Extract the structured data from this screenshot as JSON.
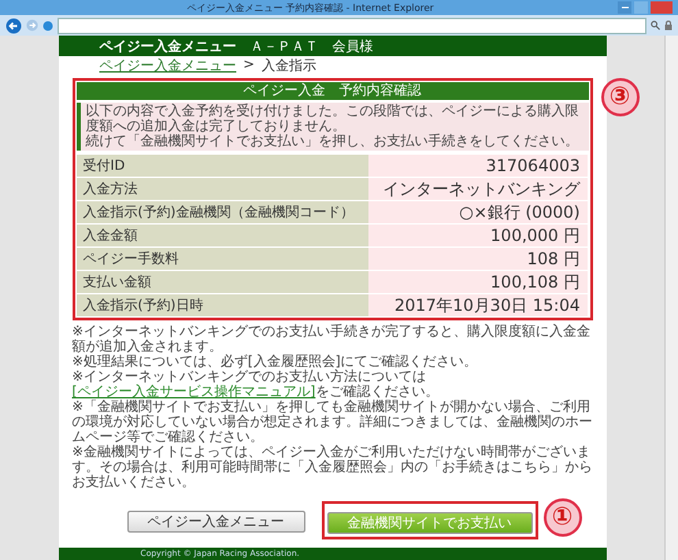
{
  "window": {
    "title": "ペイジー入金メニュー 予約内容確認 - Internet Explorer"
  },
  "header": {
    "title": "ペイジー入金メニュー",
    "subtitle": "Ａ－ＰＡＴ　会員様"
  },
  "breadcrumb": {
    "separator": ">",
    "items": [
      {
        "label": "ペイジー入金メニュー",
        "link": true
      },
      {
        "label": "入金指示",
        "link": false
      }
    ]
  },
  "panel": {
    "title": "ペイジー入金　予約内容確認",
    "annotation": "③",
    "intro": [
      "以下の内容で入金予約を受け付けました。この段階では、ペイジーによる購入限度額への追加入金は完了しておりません。",
      "続けて「金融機関サイトでお支払い」を押し、お支払い手続きをしてください。"
    ],
    "rows": [
      {
        "label": "受付ID",
        "value": "317064003"
      },
      {
        "label": "入金方法",
        "value": "インターネットバンキング"
      },
      {
        "label": "入金指示(予約)金融機関（金融機関コード）",
        "value": "○×銀行 (0000)"
      },
      {
        "label": "入金金額",
        "value": "100,000 円"
      },
      {
        "label": "ペイジー手数料",
        "value": "108 円"
      },
      {
        "label": "支払い金額",
        "value": "100,108 円"
      },
      {
        "label": "入金指示(予約)日時",
        "value": "2017年10月30日 15:04"
      }
    ]
  },
  "notes": [
    {
      "text": "※インターネットバンキングでのお支払い手続きが完了すると、購入限度額に入金金額が追加入金されます。"
    },
    {
      "text": "※処理結果については、必ず[入金履歴照会]にてご確認ください。"
    },
    {
      "text": "※インターネットバンキングでのお支払い方法については",
      "link": "[ペイジー入金サービス操作マニュアル]",
      "after": "をご確認ください。"
    },
    {
      "text": "※「金融機関サイトでお支払い」を押しても金融機関サイトが開かない場合、ご利用の環境が対応していない場合が想定されます。詳細につきましては、金融機関のホームページ等でご確認ください。"
    },
    {
      "text": "※金融機関サイトによっては、ペイジー入金がご利用いただけない時間帯がございます。その場合は、利用可能時間帯に「入金履歴照会」内の「お手続きはこちら」からお支払いください。"
    }
  ],
  "buttons": [
    {
      "label": "ペイジー入金メニュー",
      "kind": "secondary"
    },
    {
      "label": "金融機関サイトでお支払い",
      "kind": "primary",
      "annotation": "①"
    }
  ],
  "footer": "Copyright © Japan Racing Association."
}
